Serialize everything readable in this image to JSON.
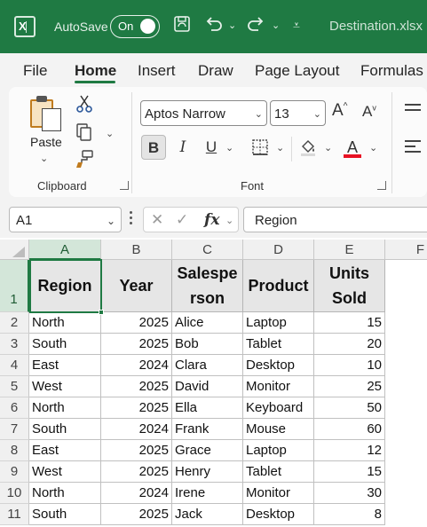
{
  "titlebar": {
    "autosave_label": "AutoSave",
    "autosave_state": "On",
    "document_title": "Destination.xlsx",
    "accent_color": "#1f7a43"
  },
  "ribbon_tabs": [
    "File",
    "Home",
    "Insert",
    "Draw",
    "Page Layout",
    "Formulas"
  ],
  "active_tab": "Home",
  "clipboard": {
    "paste_label": "Paste",
    "group_label": "Clipboard"
  },
  "font": {
    "name": "Aptos Narrow",
    "size": "13",
    "group_label": "Font",
    "font_color": "#e81123"
  },
  "formula_bar": {
    "name_box": "A1",
    "fx_label": "fx",
    "formula": "Region"
  },
  "sheet": {
    "columns": [
      "A",
      "B",
      "C",
      "D",
      "E",
      "F"
    ],
    "selected_column": "A",
    "selected_row": "1",
    "row_numbers": [
      "1",
      "2",
      "3",
      "4",
      "5",
      "6",
      "7",
      "8",
      "9",
      "10",
      "11"
    ],
    "headers": [
      [
        "Region"
      ],
      [
        "Year"
      ],
      [
        "Salespe",
        "rson"
      ],
      [
        "Product"
      ],
      [
        "Units",
        "Sold"
      ]
    ],
    "rows": [
      [
        "North",
        "2025",
        "Alice",
        "Laptop",
        "15"
      ],
      [
        "South",
        "2025",
        "Bob",
        "Tablet",
        "20"
      ],
      [
        "East",
        "2024",
        "Clara",
        "Desktop",
        "10"
      ],
      [
        "West",
        "2025",
        "David",
        "Monitor",
        "25"
      ],
      [
        "North",
        "2025",
        "Ella",
        "Keyboard",
        "50"
      ],
      [
        "South",
        "2024",
        "Frank",
        "Mouse",
        "60"
      ],
      [
        "East",
        "2025",
        "Grace",
        "Laptop",
        "12"
      ],
      [
        "West",
        "2025",
        "Henry",
        "Tablet",
        "15"
      ],
      [
        "North",
        "2024",
        "Irene",
        "Monitor",
        "30"
      ],
      [
        "South",
        "2025",
        "Jack",
        "Desktop",
        "8"
      ]
    ]
  }
}
